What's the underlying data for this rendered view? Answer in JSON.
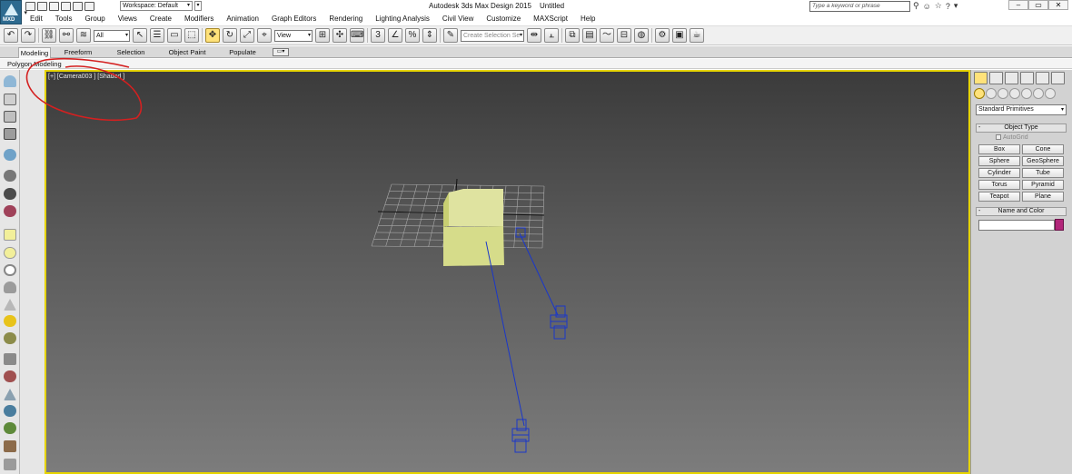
{
  "app": {
    "badge": "MXD",
    "title": "Autodesk 3ds Max Design 2015",
    "document": "Untitled",
    "workspace": "Workspace: Default",
    "search_placeholder": "Type a keyword or phrase"
  },
  "menubar": [
    "Edit",
    "Tools",
    "Group",
    "Views",
    "Create",
    "Modifiers",
    "Animation",
    "Graph Editors",
    "Rendering",
    "Lighting Analysis",
    "Civil View",
    "Customize",
    "MAXScript",
    "Help"
  ],
  "toolbar": {
    "selection_filter": "All",
    "reference_coord": "View",
    "named_selection_placeholder": "Create Selection Se"
  },
  "ribbon": {
    "tabs": [
      "Modeling",
      "Freeform",
      "Selection",
      "Object Paint",
      "Populate"
    ],
    "active_tab": "Modeling",
    "sub_panel": "Polygon Modeling"
  },
  "viewport": {
    "label": "[+] [Camera003 ] [Shaded ]",
    "active_border_color": "#e6d400",
    "box_color": "#d9e08c",
    "wireframe_color": "#1a37c9"
  },
  "command_panel": {
    "category_dropdown": "Standard Primitives",
    "object_type": {
      "header": "Object Type",
      "autogrid_label": "AutoGrid",
      "buttons": [
        "Box",
        "Cone",
        "Sphere",
        "GeoSphere",
        "Cylinder",
        "Tube",
        "Torus",
        "Pyramid",
        "Teapot",
        "Plane"
      ]
    },
    "name_and_color": {
      "header": "Name and Color",
      "name_value": "",
      "color": "#b2267a"
    }
  },
  "annotation": {
    "color": "#d42020"
  }
}
